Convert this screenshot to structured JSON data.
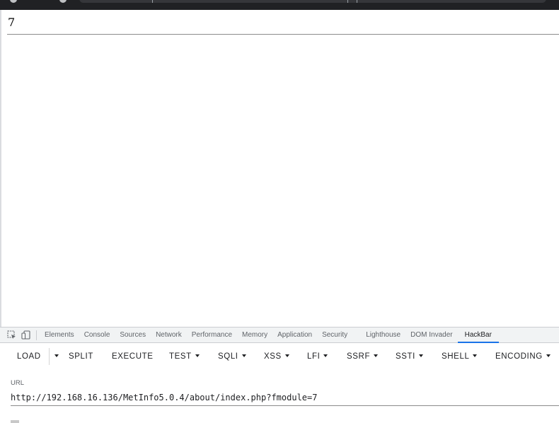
{
  "page": {
    "output_text": "7"
  },
  "devtools": {
    "tabs": [
      {
        "label": "Elements"
      },
      {
        "label": "Console"
      },
      {
        "label": "Sources"
      },
      {
        "label": "Network"
      },
      {
        "label": "Performance"
      },
      {
        "label": "Memory"
      },
      {
        "label": "Application"
      },
      {
        "label": "Security"
      },
      {
        "label": "Lighthouse"
      },
      {
        "label": "DOM Invader"
      },
      {
        "label": "HackBar"
      }
    ],
    "active_tab": "HackBar",
    "icons": [
      "inspect-element-icon",
      "device-toolbar-icon"
    ]
  },
  "hackbar": {
    "buttons": [
      {
        "label": "LOAD",
        "dropdown": false
      },
      {
        "label": "SPLIT",
        "dropdown": false
      },
      {
        "label": "EXECUTE",
        "dropdown": false
      },
      {
        "label": "TEST",
        "dropdown": true
      },
      {
        "label": "SQLI",
        "dropdown": true
      },
      {
        "label": "XSS",
        "dropdown": true
      },
      {
        "label": "LFI",
        "dropdown": true
      },
      {
        "label": "SSRF",
        "dropdown": true
      },
      {
        "label": "SSTI",
        "dropdown": true
      },
      {
        "label": "SHELL",
        "dropdown": true
      },
      {
        "label": "ENCODING",
        "dropdown": true
      }
    ],
    "url_label": "URL",
    "url_value": "http://192.168.16.136/MetInfo5.0.4/about/index.php?fmodule=7"
  }
}
